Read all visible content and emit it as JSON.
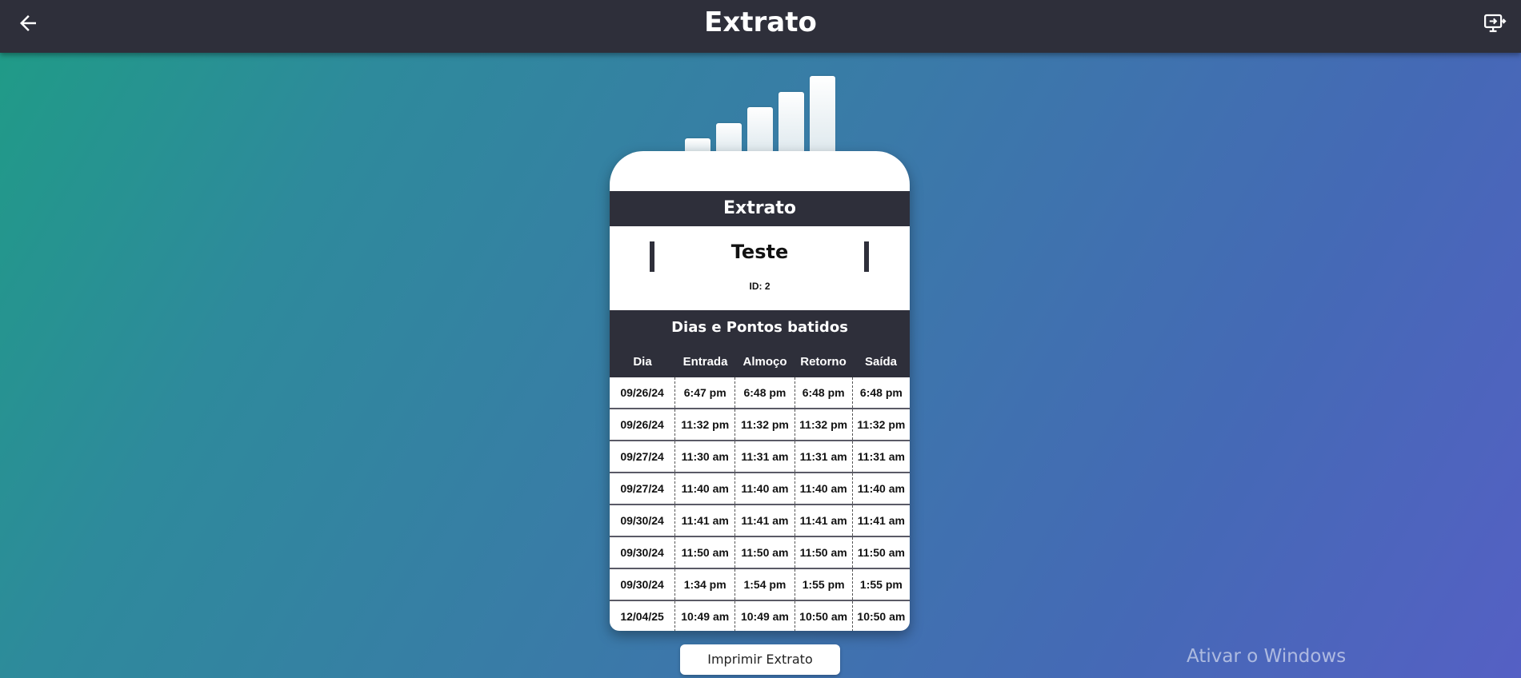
{
  "header": {
    "title": "Extrato",
    "back_icon": "arrow-left-icon",
    "screen_icon": "monitor-arrow-icon"
  },
  "card": {
    "title": "Extrato",
    "user_name": "Teste",
    "user_id": "ID: 2",
    "section_title": "Dias e Pontos batidos",
    "columns": [
      "Dia",
      "Entrada",
      "Almoço",
      "Retorno",
      "Saída"
    ],
    "rows": [
      [
        "09/26/24",
        "6:47 pm",
        "6:48 pm",
        "6:48 pm",
        "6:48 pm"
      ],
      [
        "09/26/24",
        "11:32 pm",
        "11:32 pm",
        "11:32 pm",
        "11:32 pm"
      ],
      [
        "09/27/24",
        "11:30 am",
        "11:31 am",
        "11:31 am",
        "11:31 am"
      ],
      [
        "09/27/24",
        "11:40 am",
        "11:40 am",
        "11:40 am",
        "11:40 am"
      ],
      [
        "09/30/24",
        "11:41 am",
        "11:41 am",
        "11:41 am",
        "11:41 am"
      ],
      [
        "09/30/24",
        "11:50 am",
        "11:50 am",
        "11:50 am",
        "11:50 am"
      ],
      [
        "09/30/24",
        "1:34 pm",
        "1:54 pm",
        "1:55 pm",
        "1:55 pm"
      ],
      [
        "12/04/25",
        "10:49 am",
        "10:49 am",
        "10:50 am",
        "10:50 am"
      ]
    ]
  },
  "print_button": "Imprimir Extrato",
  "watermark": "Ativar o Windows",
  "colors": {
    "bar_dark": "#2e2f3a",
    "gradient_start": "#1f9c86",
    "gradient_end": "#5560c4"
  }
}
